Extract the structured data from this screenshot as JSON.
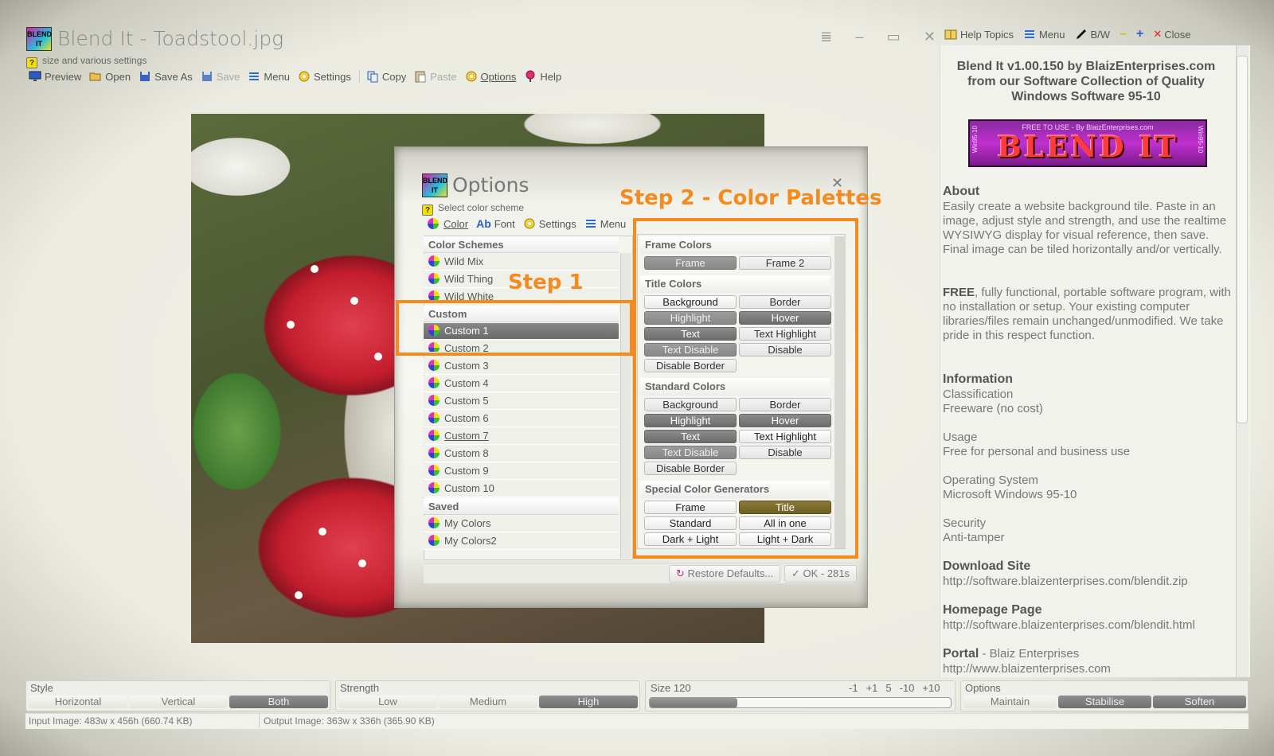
{
  "app": {
    "logo_text": "BLEND IT",
    "title": "Blend It - Toadstool.jpg",
    "title_controls": [
      "≣",
      "–",
      "▭",
      "✕"
    ],
    "subtitle": "size and various settings"
  },
  "toolbar": {
    "preview": "Preview",
    "open": "Open",
    "save_as": "Save As",
    "save": "Save",
    "menu": "Menu",
    "settings": "Settings",
    "copy": "Copy",
    "paste": "Paste",
    "options": "Options",
    "help": "Help"
  },
  "dialog": {
    "logo_text": "BLEND IT",
    "title": "Options",
    "close": "✕",
    "subtitle": "Select color scheme",
    "tabs": {
      "color": "Color",
      "font_glyph": "Ab",
      "font": "Font",
      "settings": "Settings",
      "menu": "Menu"
    },
    "schemes": {
      "header_schemes": "Color Schemes",
      "schemes": [
        "Wild Mix",
        "Wild Thing",
        "Wild White"
      ],
      "header_custom": "Custom",
      "custom": [
        "Custom 1",
        "Custom 2",
        "Custom 3",
        "Custom 4",
        "Custom 5",
        "Custom 6",
        "Custom 7",
        "Custom 8",
        "Custom 9",
        "Custom 10"
      ],
      "header_saved": "Saved",
      "saved": [
        "My Colors",
        "My Colors2"
      ]
    },
    "palettes": {
      "frame_colors": "Frame Colors",
      "frame": "Frame",
      "frame2": "Frame 2",
      "title_colors": "Title Colors",
      "t_background": "Background",
      "t_border": "Border",
      "t_highlight": "Highlight",
      "t_hover": "Hover",
      "t_text": "Text",
      "t_text_highlight": "Text Highlight",
      "t_text_disable": "Text Disable",
      "t_disable": "Disable",
      "t_disable_border": "Disable Border",
      "standard_colors": "Standard Colors",
      "s_background": "Background",
      "s_border": "Border",
      "s_highlight": "Highlight",
      "s_hover": "Hover",
      "s_text": "Text",
      "s_text_highlight": "Text Highlight",
      "s_text_disable": "Text Disable",
      "s_disable": "Disable",
      "s_disable_border": "Disable Border",
      "special": "Special Color Generators",
      "g_frame": "Frame",
      "g_title": "Title",
      "g_standard": "Standard",
      "g_all": "All in one",
      "g_dark_light": "Dark + Light",
      "g_light_dark": "Light + Dark"
    },
    "restore": "Restore Defaults...",
    "ok": "OK - 281s"
  },
  "annotations": {
    "step1": "Step 1",
    "step2": "Step 2 - Color Palettes"
  },
  "help_bar": {
    "topics": "Help Topics",
    "menu": "Menu",
    "bw": "B/W",
    "minus": "–",
    "plus": "+",
    "close": "Close"
  },
  "help": {
    "heading_1": "Blend It v1.00.150 by BlaizEnterprises.com",
    "heading_2": "from our Software Collection of Quality",
    "heading_3": "Windows Software 95-10",
    "banner_top": "FREE TO USE - By BlaizEnterprises.com",
    "banner_main": "BLEND IT",
    "banner_side_left": "Win95-10",
    "banner_side_right": "Win95-10",
    "about_title": "About",
    "about_text": "Easily create a website background tile.  Paste in an image, adjust style and strength, and use the realtime WYSIWYG display for visual reference, then save.  Final image can be tiled horizontally and/or vertically.",
    "free_bold": "FREE",
    "free_text": ", fully functional, portable software program, with no installation or setup. Your existing computer libraries/files remain unchanged/unmodified.  We take pride in this respect function.",
    "info_title": "Information",
    "classification": "Classification",
    "classification_val": "Freeware (no cost)",
    "usage": "Usage",
    "usage_val": "Free for personal and business use",
    "os": "Operating System",
    "os_val": "Microsoft Windows 95-10",
    "security": "Security",
    "security_val": "Anti-tamper",
    "download_title": "Download Site",
    "download_url": "http://software.blaizenterprises.com/blendit.zip",
    "homepage_title": "Homepage Page",
    "homepage_url": "http://software.blaizenterprises.com/blendit.html",
    "portal_title": "Portal",
    "portal_text": " - Blaiz Enterprises",
    "portal_url": "http://www.blaizenterprises.com"
  },
  "bottom": {
    "style_label": "Style",
    "style_h": "Horizontal",
    "style_v": "Vertical",
    "style_b": "Both",
    "strength_label": "Strength",
    "str_low": "Low",
    "str_med": "Medium",
    "str_high": "High",
    "size_label": "Size 120",
    "size_steps": [
      "-1",
      "+1",
      "5",
      "-10",
      "+10"
    ],
    "size_level": 0.29,
    "options_label": "Options",
    "opt_maintain": "Maintain",
    "opt_stabilise": "Stabilise",
    "opt_soften": "Soften",
    "input_status": "Input Image: 483w x 456h (660.74 KB)",
    "output_status": "Output Image: 363w x 336h (365.90 KB)"
  }
}
